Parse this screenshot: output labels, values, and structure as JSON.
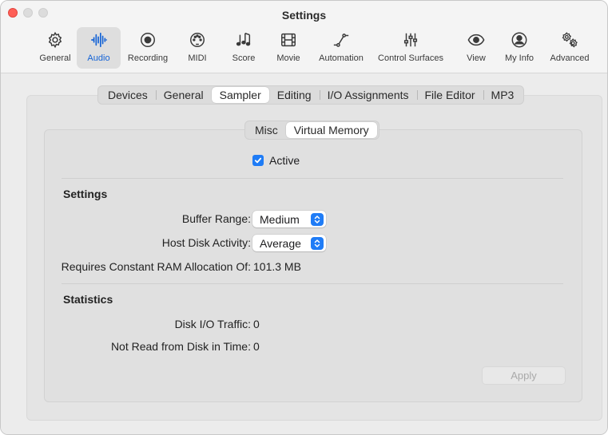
{
  "window": {
    "title": "Settings"
  },
  "toolbar": [
    {
      "label": "General",
      "icon": "gear-icon"
    },
    {
      "label": "Audio",
      "icon": "waveform-icon",
      "active": true
    },
    {
      "label": "Recording",
      "icon": "record-icon"
    },
    {
      "label": "MIDI",
      "icon": "midi-icon"
    },
    {
      "label": "Score",
      "icon": "score-icon"
    },
    {
      "label": "Movie",
      "icon": "film-icon"
    },
    {
      "label": "Automation",
      "icon": "automation-icon"
    },
    {
      "label": "Control Surfaces",
      "icon": "sliders-icon"
    },
    {
      "label": "View",
      "icon": "eye-icon"
    },
    {
      "label": "My Info",
      "icon": "person-icon"
    },
    {
      "label": "Advanced",
      "icon": "gears-icon"
    }
  ],
  "tabs": [
    "Devices",
    "General",
    "Sampler",
    "Editing",
    "I/O Assignments",
    "File Editor",
    "MP3"
  ],
  "active_tab": "Sampler",
  "subtabs": [
    "Misc",
    "Virtual Memory"
  ],
  "active_subtab": "Virtual Memory",
  "active_checkbox": {
    "label": "Active",
    "checked": true
  },
  "settings": {
    "title": "Settings",
    "buffer_range_label": "Buffer Range:",
    "buffer_range_value": "Medium",
    "host_disk_label": "Host Disk Activity:",
    "host_disk_value": "Average",
    "ram_label": "Requires Constant RAM Allocation Of:",
    "ram_value": "101.3 MB"
  },
  "statistics": {
    "title": "Statistics",
    "disk_io_label": "Disk I/O Traffic:",
    "disk_io_value": "0",
    "not_read_label": "Not Read from Disk in Time:",
    "not_read_value": "0"
  },
  "apply_label": "Apply",
  "colors": {
    "accent": "#1f7cf6",
    "active_toolbar_text": "#1463d6",
    "close": "#fe5f57"
  }
}
